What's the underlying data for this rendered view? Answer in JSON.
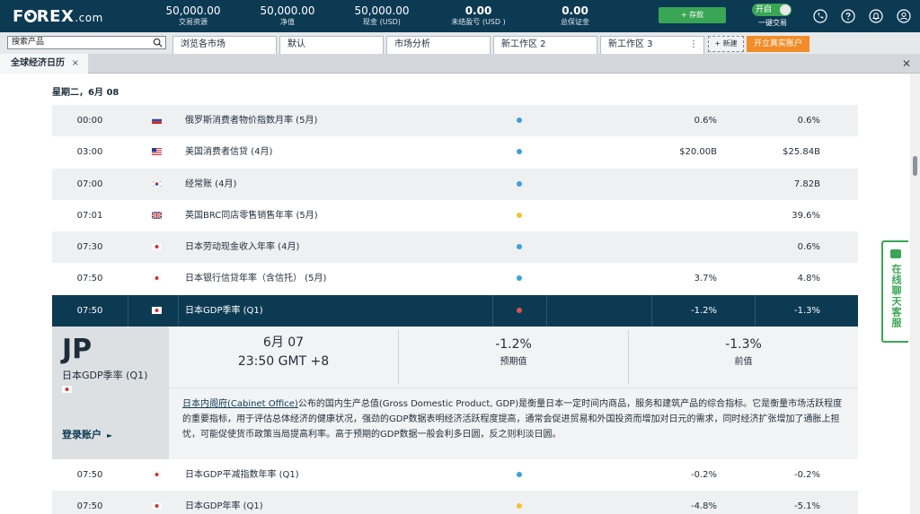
{
  "brand": {
    "logo_text_a": "F",
    "logo_text_b": "REX",
    "logo_suffix": ".com"
  },
  "account": {
    "stats": [
      {
        "value": "50,000.00",
        "label": "交易资源",
        "bold": false
      },
      {
        "value": "50,000.00",
        "label": "净值",
        "bold": false
      },
      {
        "value": "50,000.00",
        "label": "现金 (USD)",
        "bold": false
      },
      {
        "value": "0.00",
        "label": "未结盈亏 (USD )",
        "bold": true
      },
      {
        "value": "0.00",
        "label": "总保证金",
        "bold": true
      }
    ],
    "deposit_label": "+ 存款",
    "toggle_on_label": "开启",
    "toggle_caption": "一键交易"
  },
  "toolbar": {
    "search_value": "搜索产品",
    "tabs": [
      "浏览各市场",
      "默认",
      "市场分析",
      "新工作区 2",
      "新工作区 3"
    ],
    "tab_more": "⋮",
    "new_tab_label": "+ 新建",
    "live_account_label": "开立真实账户"
  },
  "panel": {
    "tab_label": "全球经济日历",
    "tab_close": "×",
    "panel_close": "✕"
  },
  "calendar": {
    "day_label": "星期二，6月 08",
    "rows": [
      {
        "time": "00:00",
        "country": "RU",
        "name": "俄罗斯消费者物价指数月率 (5月)",
        "impact": "#3aa0dc",
        "forecast": "0.6%",
        "previous": "0.6%"
      },
      {
        "time": "03:00",
        "country": "US",
        "name": "美国消费者信贷 (4月)",
        "impact": "#3aa0dc",
        "forecast": "$20.00B",
        "previous": "$25.84B"
      },
      {
        "time": "07:00",
        "country": "KR",
        "name": "经常账 (4月)",
        "impact": "#3aa0dc",
        "forecast": "",
        "previous": "7.82B"
      },
      {
        "time": "07:01",
        "country": "GB",
        "name": "英国BRC同店零售销售年率 (5月)",
        "impact": "#f2c230",
        "forecast": "",
        "previous": "39.6%"
      },
      {
        "time": "07:30",
        "country": "JP",
        "name": "日本劳动现金收入年率 (4月)",
        "impact": "#3aa0dc",
        "forecast": "",
        "previous": "0.6%"
      },
      {
        "time": "07:50",
        "country": "JP",
        "name": "日本银行信贷年率（含信托） (5月)",
        "impact": "#3aa0dc",
        "forecast": "3.7%",
        "previous": "4.8%"
      },
      {
        "time": "07:50",
        "country": "JP",
        "name": "日本GDP季率 (Q1)",
        "impact": "#d9534f",
        "forecast": "-1.2%",
        "previous": "-1.3%",
        "selected": true
      }
    ],
    "rows_after": [
      {
        "time": "07:50",
        "country": "JP",
        "name": "日本GDP平减指数年率 (Q1)",
        "impact": "#3aa0dc",
        "forecast": "-0.2%",
        "previous": "-0.2%"
      },
      {
        "time": "07:50",
        "country": "JP",
        "name": "日本GDP年率 (Q1)",
        "impact": "#f2c230",
        "forecast": "-4.8%",
        "previous": "-5.1%"
      }
    ]
  },
  "detail": {
    "country_code": "JP",
    "event_name": "日本GDP季率 (Q1)",
    "date": "6月 07",
    "time": "23:50 GMT +8",
    "forecast_value": "-1.2%",
    "forecast_label": "预期值",
    "previous_value": "-1.3%",
    "previous_label": "前值",
    "source_link": "日本内阁府(Cabinet Office)",
    "description": "公布的国内生产总值(Gross Domestic Product, GDP)是衡量日本一定时间内商品，服务和建筑产品的综合指标。它是衡量市场活跃程度的重要指标，用于评估总体经济的健康状况，强劲的GDP数据表明经济活跃程度提高，通常会促进贸易和外国投资而增加对日元的需求，同时经济扩张增加了通胀上担忧，可能促使货币政策当局提高利率。高于预期的GDP数据一般会利多日圆，反之则利淡日圆。",
    "login_label": "登录账户",
    "login_arrow": "►"
  },
  "chat": {
    "label": "在线聊天客服"
  },
  "colors": {
    "brand": "#0d3a53",
    "positive": "#3aa655",
    "accent": "#f28c28"
  }
}
